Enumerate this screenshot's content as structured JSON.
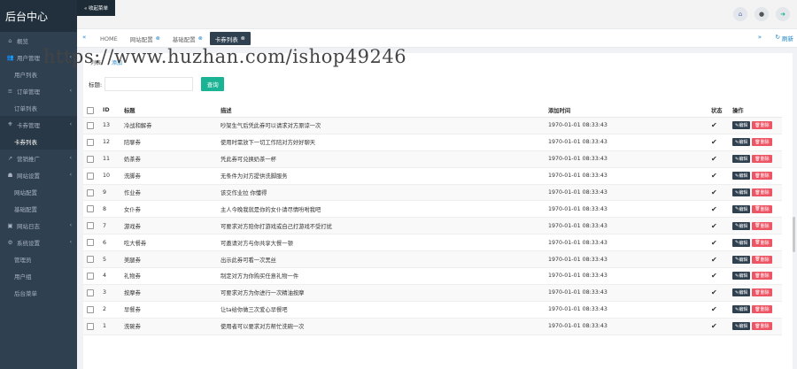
{
  "brand": "后台中心",
  "topbar": {
    "collapse_label": "« 收起菜单",
    "icons": [
      "home-icon",
      "user-icon",
      "logout-icon"
    ]
  },
  "sidebar": {
    "items": [
      {
        "icon": "⌂",
        "label": "概览",
        "children": []
      },
      {
        "icon": "👥",
        "label": "用户管理",
        "children": [
          "用户列表"
        ]
      },
      {
        "icon": "≡",
        "label": "订单管理",
        "children": [
          "订单列表"
        ]
      },
      {
        "icon": "⎈",
        "label": "卡券管理",
        "children": [
          "卡券列表"
        ]
      },
      {
        "icon": "↗",
        "label": "营销推广",
        "children": []
      },
      {
        "icon": "☗",
        "label": "网站设置",
        "children": [
          "网站配置",
          "基础配置"
        ]
      },
      {
        "icon": "▣",
        "label": "网站日志",
        "children": []
      },
      {
        "icon": "⚙",
        "label": "系统设置",
        "children": [
          "管理员",
          "用户组",
          "后台菜单"
        ]
      }
    ]
  },
  "tabs": {
    "items": [
      {
        "label": "HOME",
        "closable": false
      },
      {
        "label": "网站配置",
        "closable": true
      },
      {
        "label": "基础配置",
        "closable": true
      },
      {
        "label": "卡券列表",
        "closable": true,
        "active": true
      }
    ],
    "refresh_label": "刷新"
  },
  "watermark": "https://www.huzhan.com/ishop49246",
  "breadcrumb": {
    "current": "列表",
    "link": "添加"
  },
  "filter": {
    "label": "标题:",
    "value": "",
    "button": "查询"
  },
  "table": {
    "headers": {
      "id": "ID",
      "title": "标题",
      "desc": "描述",
      "time": "添加时间",
      "status": "状态",
      "ops": "操作"
    },
    "edit_label": "编辑",
    "delete_label": "删除",
    "rows": [
      {
        "id": "13",
        "title": "冷战和解券",
        "desc": "吵架生气后凭此券可以请求对方原谅一次",
        "time": "1970-01-01 08:33:43"
      },
      {
        "id": "12",
        "title": "陪聊券",
        "desc": "使用时需放下一切工作陪对方好好聊天",
        "time": "1970-01-01 08:33:43"
      },
      {
        "id": "11",
        "title": "奶茶券",
        "desc": "凭此券可兑换奶茶一杯",
        "time": "1970-01-01 08:33:43"
      },
      {
        "id": "10",
        "title": "洗脚券",
        "desc": "无条件为对方提供洗脚服务",
        "time": "1970-01-01 08:33:43"
      },
      {
        "id": "9",
        "title": "作业券",
        "desc": "该交作业拉 你懂得",
        "time": "1970-01-01 08:33:43"
      },
      {
        "id": "8",
        "title": "女仆券",
        "desc": "主人今晚我就是你的女仆请尽情吩咐我吧",
        "time": "1970-01-01 08:33:43"
      },
      {
        "id": "7",
        "title": "游戏券",
        "desc": "可要求对方陪你打游戏或自己打游戏不受打扰",
        "time": "1970-01-01 08:33:43"
      },
      {
        "id": "6",
        "title": "吃大餐券",
        "desc": "可邀请对方与你共享大餐一顿",
        "time": "1970-01-01 08:33:43"
      },
      {
        "id": "5",
        "title": "美腿券",
        "desc": "出示此券可看一次黑丝",
        "time": "1970-01-01 08:33:43"
      },
      {
        "id": "4",
        "title": "礼物券",
        "desc": "制定对方为你购买任意礼物一件",
        "time": "1970-01-01 08:33:43"
      },
      {
        "id": "3",
        "title": "按摩券",
        "desc": "可要求对方为你进行一次精油按摩",
        "time": "1970-01-01 08:33:43"
      },
      {
        "id": "2",
        "title": "早餐券",
        "desc": "让ta给你做三次爱心早餐吧",
        "time": "1970-01-01 08:33:43"
      },
      {
        "id": "1",
        "title": "洗碗券",
        "desc": "使用者可以要求对方帮忙洗碗一次",
        "time": "1970-01-01 08:33:43"
      }
    ]
  }
}
